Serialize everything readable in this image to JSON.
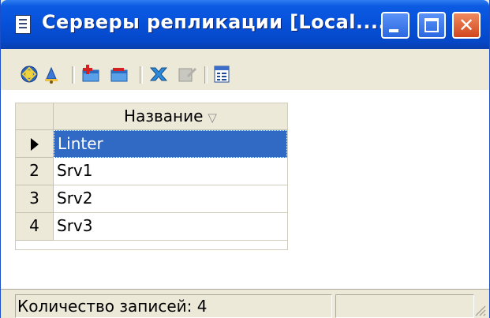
{
  "window": {
    "title": "Серверы репликации [Local....",
    "minimize_icon": "minimize-icon",
    "maximize_icon": "maximize-icon",
    "close_icon": "close-icon",
    "close_glyph": "✕"
  },
  "toolbar": {
    "buttons": [
      {
        "icon": "refresh-icon"
      },
      {
        "icon": "bell-icon"
      },
      {
        "icon": "add-record-icon"
      },
      {
        "icon": "delete-record-icon"
      },
      {
        "icon": "close-cross-icon"
      },
      {
        "icon": "edit-disabled-icon"
      },
      {
        "icon": "table-view-icon"
      }
    ]
  },
  "grid": {
    "column_header": "Название",
    "sort_glyph": "▽",
    "rows": [
      {
        "indicator": "",
        "name": "Linter",
        "selected": true
      },
      {
        "indicator": "2",
        "name": "Srv1",
        "selected": false
      },
      {
        "indicator": "3",
        "name": "Srv2",
        "selected": false
      },
      {
        "indicator": "4",
        "name": "Srv3",
        "selected": false
      }
    ]
  },
  "status": {
    "record_count_text": "Количество записей: 4",
    "second_panel": ""
  },
  "colors": {
    "titlebar": "#0650d8",
    "selection": "#316ac5",
    "close_button": "#d2471e",
    "face": "#ece9d8"
  }
}
